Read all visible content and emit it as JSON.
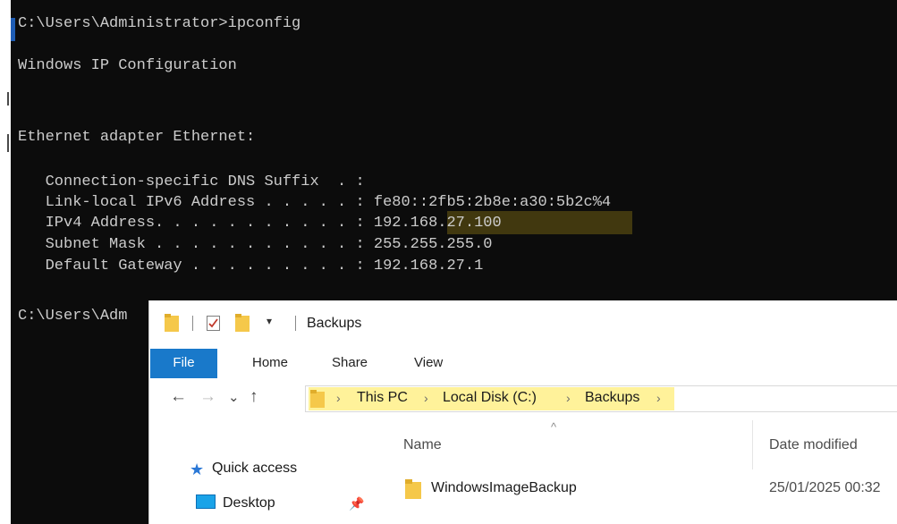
{
  "console": {
    "lines": [
      "C:\\Users\\Administrator>ipconfig",
      "Windows IP Configuration",
      "Ethernet adapter Ethernet:",
      "   Connection-specific DNS Suffix  . :",
      "   Link-local IPv6 Address . . . . . : fe80::2fb5:2b8e:a30:5b2c%4",
      "   IPv4 Address. . . . . . . . . . . : 192.168.27.100",
      "   Subnet Mask . . . . . . . . . . . : 255.255.255.0",
      "   Default Gateway . . . . . . . . . : 192.168.27.1",
      "C:\\Users\\Adm"
    ]
  },
  "explorer": {
    "title": "Backups",
    "tabs": [
      "File",
      "Home",
      "Share",
      "View"
    ],
    "nav": {
      "back": "←",
      "forward": "→",
      "recent": "⌄",
      "up": "↑"
    },
    "breadcrumb": [
      "This PC",
      "Local Disk (C:)",
      "Backups"
    ],
    "nav_pane": {
      "quick_access": "Quick access",
      "desktop": "Desktop"
    },
    "columns": {
      "name": "Name",
      "date_modified": "Date modified"
    },
    "files": [
      {
        "name": "WindowsImageBackup",
        "date": "25/01/2025 00:32"
      }
    ]
  },
  "icons": {
    "folder": "folder-icon",
    "properties": "properties-icon",
    "star": "star-icon",
    "pin": "pin-icon"
  },
  "colors": {
    "console_bg": "#0c0c0c",
    "console_text": "#cccccc",
    "file_tab": "#1979ca",
    "address_highlight": "#fff29a",
    "folder_yellow": "#f5c84a"
  }
}
